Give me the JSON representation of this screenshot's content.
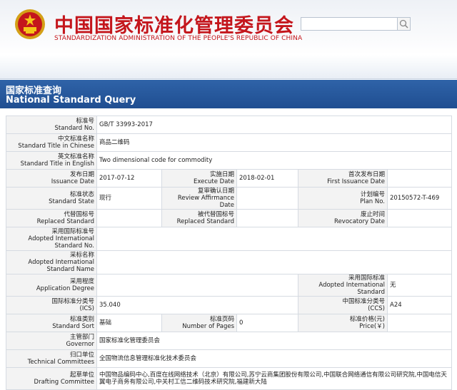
{
  "header": {
    "title_cn": "中国国家标准化管理委员会",
    "title_en": "STANDARDIZATION ADMINISTRATION OF THE PEOPLE'S REPUBLIC OF CHINA"
  },
  "band": {
    "title_cn": "国家标准查询",
    "title_en": "National Standard Query"
  },
  "fields": {
    "std_no": {
      "cn": "标准号",
      "en": "Standard No.",
      "value": "GB/T 33993-2017"
    },
    "title_cn": {
      "cn": "中文标准名称",
      "en": "Standard Title in Chinese",
      "value": "商品二维码"
    },
    "title_en": {
      "cn": "英文标准名称",
      "en": "Standard Title in English",
      "value": "Two dimensional code for commodity"
    },
    "issuance_date": {
      "cn": "发布日期",
      "en": "Issuance Date",
      "value": "2017-07-12"
    },
    "execute_date": {
      "cn": "实施日期",
      "en": "Execute Date",
      "value": "2018-02-01"
    },
    "first_issuance": {
      "cn": "首次发布日期",
      "en": "First Issuance Date",
      "value": ""
    },
    "state": {
      "cn": "标准状态",
      "en": "Standard State",
      "value": "现行"
    },
    "review": {
      "cn": "复审确认日期",
      "en": "Review Affirmance Date",
      "value": ""
    },
    "plan_no": {
      "cn": "计划编号",
      "en": "Plan No.",
      "value": "20150572-T-469"
    },
    "replaced": {
      "cn": "代替国标号",
      "en": "Replaced Standard",
      "value": ""
    },
    "replaced_by": {
      "cn": "被代替国标号",
      "en": "Replaced Standard",
      "value": ""
    },
    "revocatory": {
      "cn": "废止时间",
      "en": "Revocatory Date",
      "value": ""
    },
    "adopted_no": {
      "cn": "采用国际标准号",
      "en": "Adopted International Standard No.",
      "value": ""
    },
    "adopted_name": {
      "cn": "采标名称",
      "en": "Adopted International Standard Name",
      "value": ""
    },
    "app_degree": {
      "cn": "采用程度",
      "en": "Application Degree",
      "value": ""
    },
    "adopted_std": {
      "cn": "采用国际标准",
      "en": "Adopted International Standard",
      "value": "无"
    },
    "ics": {
      "cn": "国际标准分类号",
      "en": "(ICS)",
      "value": "35.040"
    },
    "ccs": {
      "cn": "中国标准分类号",
      "en": "(CCS)",
      "value": "A24"
    },
    "sort": {
      "cn": "标准类别",
      "en": "Standard Sort",
      "value": "基础"
    },
    "pages": {
      "cn": "标准页码",
      "en": "Number of Pages",
      "value": "0"
    },
    "price": {
      "cn": "标准价格(元)",
      "en": "Price(￥)",
      "value": ""
    },
    "governor": {
      "cn": "主管部门",
      "en": "Governor",
      "value": "国家标准化管理委员会"
    },
    "committees": {
      "cn": "归口单位",
      "en": "Technical Committees",
      "value": "全国物流信息管理标准化技术委员会"
    },
    "drafting": {
      "cn": "起草单位",
      "en": "Drafting Committee",
      "value": "中国物品编码中心,百度在线网络技术（北京）有限公司,苏宁云商集团股份有限公司,中国联合网络通信有限公司研究院,中国电信天翼电子商务有限公司,中关村工信二维码技术研究院,福建新大陆"
    }
  },
  "colors": {
    "accent_red": "#c4161c",
    "band_blue": "#2a5ba0",
    "link_blue": "#1a5fb4"
  }
}
